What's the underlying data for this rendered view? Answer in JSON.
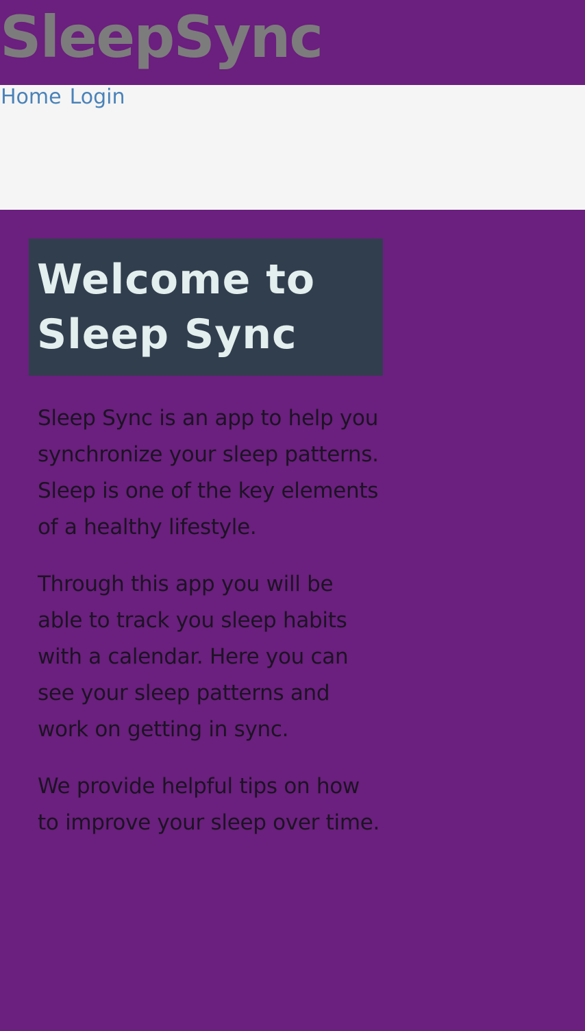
{
  "header": {
    "brand": "SleepSync"
  },
  "nav": {
    "links": [
      {
        "label": "Home"
      },
      {
        "label": "Login"
      }
    ]
  },
  "main": {
    "welcome_title": "Welcome to Sleep Sync",
    "paragraphs": [
      "Sleep Sync is an app to help you synchronize your sleep patterns. Sleep is one of the key elements of a healthy lifestyle.",
      "Through this app you will be able to track you sleep habits with a calendar. Here you can see your sleep patterns and work on getting in sync.",
      "We provide helpful tips on how to improve your sleep over time."
    ]
  },
  "colors": {
    "page_background": "#6b1f7e",
    "nav_background": "#f5f5f5",
    "brand_text": "#7c7c7c",
    "link": "#4a82b8",
    "welcome_box": "#313e4e",
    "welcome_text": "#e3eeee",
    "body_text": "#1c1324"
  }
}
